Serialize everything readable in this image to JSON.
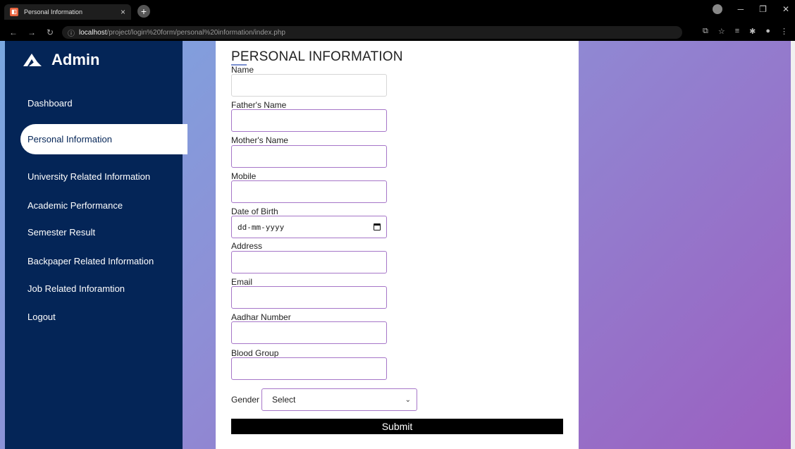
{
  "browser": {
    "tab_title": "Personal Information",
    "new_tab": "+",
    "url_host": "localhost",
    "url_path": "/project/login%20form/personal%20information/index.php"
  },
  "sidebar": {
    "brand": "Admin",
    "items": [
      {
        "label": "Dashboard"
      },
      {
        "label": "Personal Information",
        "active": true
      },
      {
        "label": "University Related Information"
      },
      {
        "label": "Academic Performance"
      },
      {
        "label": "Semester Result"
      },
      {
        "label": "Backpaper Related Information"
      },
      {
        "label": "Job Related Inforamtion"
      },
      {
        "label": "Logout"
      }
    ]
  },
  "form": {
    "title": "PERSONAL INFORMATION",
    "fields": [
      {
        "label": "Name",
        "value": ""
      },
      {
        "label": "Father's Name",
        "value": ""
      },
      {
        "label": "Mother's Name",
        "value": ""
      },
      {
        "label": "Mobile",
        "value": ""
      },
      {
        "label": "Date of Birth",
        "placeholder": "dd-mm-yyyy"
      },
      {
        "label": "Address",
        "value": ""
      },
      {
        "label": "Email",
        "value": ""
      },
      {
        "label": "Aadhar Number",
        "value": ""
      },
      {
        "label": "Blood Group",
        "value": ""
      }
    ],
    "gender": {
      "label": "Gender",
      "selected": "Select"
    },
    "submit_label": "Submit"
  },
  "colors": {
    "sidebar_bg": "#042557",
    "input_border": "#a676c8",
    "gradient_start": "#7aa8e0",
    "gradient_end": "#9b5fc0"
  }
}
